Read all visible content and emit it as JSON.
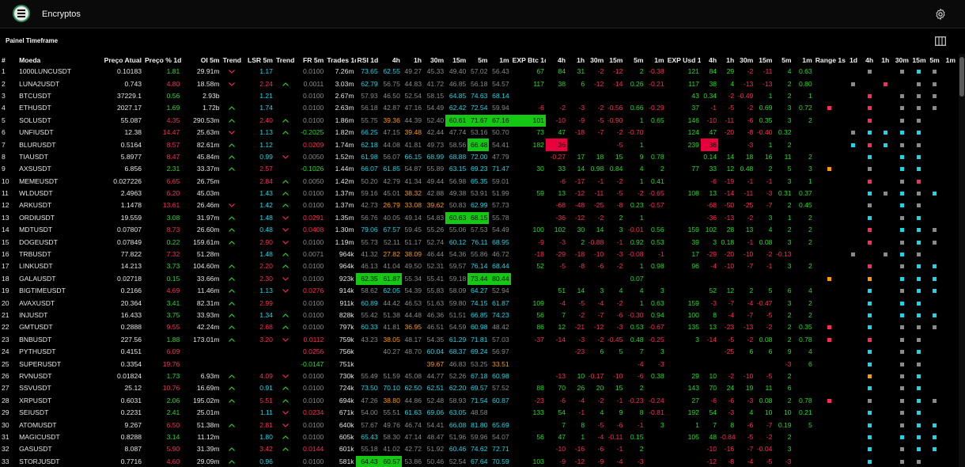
{
  "app": {
    "title": "Encryptos",
    "panel_title": "Painel Timeframe"
  },
  "colors": {
    "green": "#22dd22",
    "red": "#ff2a55",
    "cyan": "#18d8e8",
    "orange": "#ff9a00",
    "gray": "#8a8a8a",
    "white": "#e6e6e6",
    "bg_green": "#14c814",
    "bg_red": "#e8003c"
  },
  "columns": [
    "#",
    "Moeda",
    "Preço Atual",
    "Preço % 1d",
    "OI 5m",
    "Trend 5m",
    "LSR 5m",
    "Trend 5m",
    "FR 5m",
    "Trades 1d",
    "RSI 1d",
    "4h",
    "1h",
    "30m",
    "15m",
    "5m",
    "1m",
    "EXP Btc 1d",
    "4h",
    "1h",
    "30m",
    "15m",
    "5m",
    "1m",
    "EXP Usd 1d",
    "4h",
    "1h",
    "30m",
    "15m",
    "5m",
    "1m",
    "Range 1s",
    "1d",
    "4h",
    "1h",
    "30m",
    "15m",
    "5m",
    "1m"
  ],
  "rows": [
    [
      "1",
      "1000LUNCUSDT",
      "0.10183",
      "1.81",
      "29.91m",
      "v",
      "1.17",
      "",
      "0.0100",
      "7.26m",
      "73.65",
      "62.55",
      "49.27",
      "45.33",
      "49.40",
      "57.02",
      "56.43",
      "67",
      "84",
      "31",
      "-2",
      "-12",
      "2",
      "-0.38",
      "121",
      "84",
      "29",
      "-2",
      "-11",
      "4",
      "0.63",
      "",
      "",
      "g",
      "",
      "g",
      "c",
      "g",
      ""
    ],
    [
      "2",
      "LUNA2USDT",
      "0.743",
      "4.80",
      "18.58m",
      "v",
      "2.24",
      "^",
      "0.0011",
      "3.03m",
      "62.79",
      "56.75",
      "44.83",
      "41.72",
      "46.85",
      "56.18",
      "54.57",
      "117",
      "38",
      "6",
      "-12",
      "-14",
      "0.26",
      "-0.21",
      "117",
      "38",
      "4",
      "-13",
      "-13",
      "2",
      "0.80",
      "",
      "g",
      "",
      "r",
      "",
      "g",
      "g",
      ""
    ],
    [
      "3",
      "BTCUSDT",
      "37229.1",
      "0.56",
      "2.93b",
      "",
      "1.21",
      "",
      "0.0100",
      "2.67m",
      "57.93",
      "46.50",
      "52.54",
      "58.15",
      "64.85",
      "74.63",
      "68.14",
      "",
      "",
      "",
      "",
      "",
      "",
      "",
      "43",
      "0.34",
      "-2",
      "-0.49",
      "1",
      "2",
      "1",
      "",
      "",
      "r",
      "",
      "g",
      "g",
      "g",
      ""
    ],
    [
      "4",
      "ETHUSDT",
      "2027.17",
      "1.69",
      "1.72b",
      "^",
      "1.74",
      "",
      "0.0100",
      "2.63m",
      "56.18",
      "42.87",
      "47.16",
      "54.49",
      "62.42",
      "72.54",
      "59.94",
      "-6",
      "-2",
      "-3",
      "-2",
      "-0.56",
      "0.66",
      "-0.29",
      "37",
      "-1",
      "-5",
      "-2",
      "0.69",
      "3",
      "0.72",
      "r",
      "",
      "r",
      "",
      "g",
      "g",
      "g",
      ""
    ],
    [
      "5",
      "SOLUSDT",
      "55.087",
      "4.35",
      "290.53m",
      "^",
      "2.40",
      "^",
      "0.0100",
      "1.86m",
      "55.75",
      "39.36",
      "44.39",
      "52.40",
      "60.61",
      "71.67",
      "67.16",
      "101",
      "-10",
      "-9",
      "-5",
      "-0.90",
      "1",
      "0.65",
      "146",
      "-10",
      "-11",
      "-6",
      "0.35",
      "3",
      "2",
      "",
      "",
      "r",
      "",
      "g",
      "g",
      "",
      ""
    ],
    [
      "6",
      "UNFIUSDT",
      "12.38",
      "14.47",
      "25.63m",
      "v",
      "1.13",
      "^",
      "-0.2025",
      "1.82m",
      "66.25",
      "47.15",
      "39.48",
      "42.44",
      "47.74",
      "53.16",
      "50.70",
      "73",
      "47",
      "-18",
      "-7",
      "-2",
      "-0.70",
      "",
      "124",
      "47",
      "-20",
      "-8",
      "-0.40",
      "0.32",
      "",
      "",
      "g",
      "c",
      "c",
      "c",
      "c",
      ""
    ],
    [
      "7",
      "BLURUSDT",
      "0.5164",
      "8.57",
      "82.61m",
      "^",
      "1.12",
      "",
      "0.0209",
      "1.74m",
      "62.18",
      "44.08",
      "41.81",
      "49.73",
      "58.56",
      "66.48",
      "54.41",
      "182",
      "36",
      "",
      "",
      "-5",
      "1",
      "",
      "239",
      "36",
      "",
      "-3",
      "1",
      "2",
      "",
      "",
      "c",
      "r",
      "c",
      "g",
      "g",
      "",
      ""
    ],
    [
      "8",
      "TIAUSDT",
      "5.8977",
      "8.47",
      "45.84m",
      "^",
      "0.99",
      "v",
      "0.0050",
      "1.52m",
      "61.98",
      "56.07",
      "66.15",
      "68.99",
      "68.88",
      "72.00",
      "47.79",
      "",
      "-0.27",
      "17",
      "18",
      "15",
      "9",
      "0.78",
      "",
      "0.14",
      "14",
      "18",
      "16",
      "11",
      "2",
      "",
      "",
      "c",
      "",
      "c",
      "c",
      "",
      ""
    ],
    [
      "9",
      "AXSUSDT",
      "6.856",
      "2.31",
      "33.37m",
      "^",
      "2.57",
      "",
      "-0.1026",
      "1.44m",
      "66.07",
      "61.85",
      "54.87",
      "55.89",
      "63.15",
      "69.23",
      "71.47",
      "30",
      "33",
      "14",
      "0.98",
      "0.84",
      "4",
      "2",
      "77",
      "33",
      "12",
      "0.48",
      "2",
      "5",
      "3",
      "o",
      "",
      "g",
      "",
      "c",
      "c",
      "",
      ""
    ],
    [
      "10",
      "MEMEUSDT",
      "0.027226",
      "6.65",
      "26.75m",
      "",
      "2.84",
      "^",
      "0.0050",
      "1.42m",
      "50.20",
      "42.79",
      "41.34",
      "49.44",
      "56.98",
      "65.35",
      "59.01",
      "",
      "-6",
      "-17",
      "-1",
      "-2",
      "1",
      "0.41",
      "",
      "-6",
      "-19",
      "-1",
      "-1",
      "3",
      "1",
      "",
      "",
      "r",
      "",
      "g",
      "r",
      "",
      ""
    ],
    [
      "11",
      "WLDUSDT",
      "2.4963",
      "6.20",
      "45.03m",
      "",
      "1.43",
      "^",
      "0.0100",
      "1.37m",
      "59.16",
      "45.01",
      "38.32",
      "42.88",
      "49.38",
      "53.91",
      "51.99",
      "59",
      "13",
      "-12",
      "-11",
      "-5",
      "-2",
      "-0.65",
      "108",
      "13",
      "-14",
      "-11",
      "-3",
      "0.31",
      "0.37",
      "",
      "",
      "c",
      "g",
      "c",
      "g",
      "c",
      ""
    ],
    [
      "12",
      "ARKUSDT",
      "1.1478",
      "13.61",
      "26.46m",
      "v",
      "1.42",
      "^",
      "0.0100",
      "1.37m",
      "42.73",
      "26.79",
      "33.08",
      "39.62",
      "50.83",
      "62.99",
      "57.73",
      "",
      "-68",
      "-48",
      "-25",
      "-8",
      "0.23",
      "-0.57",
      "",
      "-68",
      "-50",
      "-25",
      "-7",
      "2",
      "0.45",
      "",
      "",
      "g",
      "",
      "c",
      "g",
      "",
      ""
    ],
    [
      "13",
      "ORDIUSDT",
      "19.559",
      "3.08",
      "31.97m",
      "^",
      "1.48",
      "v",
      "0.0291",
      "1.35m",
      "56.76",
      "40.05",
      "49.14",
      "54.83",
      "60.63",
      "68.15",
      "55.78",
      "",
      "-36",
      "-12",
      "-2",
      "2",
      "1",
      "",
      "",
      "-36",
      "-13",
      "-2",
      "3",
      "1",
      "2",
      "",
      "",
      "c",
      "",
      "g",
      "c",
      "",
      ""
    ],
    [
      "14",
      "MDTUSDT",
      "0.07807",
      "8.73",
      "26.60m",
      "^",
      "0.48",
      "v",
      "0.0408",
      "1.30m",
      "79.06",
      "67.57",
      "59.45",
      "55.26",
      "55.06",
      "57.53",
      "54.49",
      "100",
      "102",
      "30",
      "14",
      "3",
      "-0.01",
      "0.56",
      "159",
      "102",
      "28",
      "13",
      "4",
      "2",
      "2",
      "",
      "",
      "r",
      "",
      "c",
      "c",
      "g",
      ""
    ],
    [
      "15",
      "DOGEUSDT",
      "0.07849",
      "0.22",
      "159.61m",
      "^",
      "2.90",
      "v",
      "0.0100",
      "1.19m",
      "55.73",
      "52.11",
      "51.17",
      "52.74",
      "60.12",
      "76.11",
      "68.95",
      "-9",
      "-3",
      "2",
      "-0.88",
      "-1",
      "0.92",
      "0.53",
      "39",
      "3",
      "0.18",
      "-1",
      "0.08",
      "3",
      "2",
      "",
      "",
      "r",
      "",
      "g",
      "c",
      "g",
      ""
    ],
    [
      "16",
      "TRBUSDT",
      "77.822",
      "7.32",
      "51.28m",
      "",
      "1.48",
      "^",
      "0.0071",
      "964k",
      "41.32",
      "27.82",
      "38.09",
      "46.44",
      "54.36",
      "55.86",
      "46.72",
      "-18",
      "-29",
      "-18",
      "-10",
      "-3",
      "-0.08",
      "-1",
      "17",
      "-29",
      "-20",
      "-10",
      "-2",
      "-0.13",
      "",
      "",
      "g",
      "",
      "g",
      "c",
      "g",
      ""
    ],
    [
      "17",
      "LINKUSDT",
      "14.213",
      "3.73",
      "104.60m",
      "^",
      "2.20",
      "^",
      "0.0100",
      "964k",
      "46.13",
      "41.04",
      "49.50",
      "52.31",
      "59.57",
      "76.14",
      "68.44",
      "52",
      "-5",
      "-8",
      "-6",
      "-2",
      "1",
      "0.98",
      "96",
      "-4",
      "-10",
      "-7",
      "-1",
      "3",
      "2",
      "",
      "",
      "r",
      "",
      "g",
      "c",
      "c",
      ""
    ],
    [
      "18",
      "GALAUSDT",
      "0.02718",
      "0.15",
      "33.66m",
      "^",
      "2.30",
      "v",
      "0.0100",
      "923k",
      "62.35",
      "61.87",
      "55.34",
      "55.41",
      "59.18",
      "73.44",
      "80.44",
      "",
      "",
      "",
      "",
      "",
      "0.07",
      "",
      "",
      "",
      "",
      "",
      "",
      "",
      "",
      "o",
      "",
      "o",
      "",
      "c",
      "c",
      "c",
      ""
    ],
    [
      "19",
      "BIGTIMEUSDT",
      "0.2166",
      "4.69",
      "11.46m",
      "^",
      "1.13",
      "v",
      "0.0276",
      "914k",
      "58.62",
      "62.05",
      "54.39",
      "55.83",
      "58.09",
      "64.27",
      "52.94",
      "",
      "51",
      "14",
      "3",
      "4",
      "4",
      "3",
      "",
      "52",
      "12",
      "2",
      "5",
      "6",
      "4",
      "",
      "",
      "c",
      "",
      "g",
      "c",
      "c",
      ""
    ],
    [
      "20",
      "AVAXUSDT",
      "20.364",
      "3.41",
      "82.31m",
      "^",
      "2.99",
      "",
      "0.0100",
      "911k",
      "60.89",
      "44.42",
      "46.53",
      "51.63",
      "59.80",
      "74.15",
      "61.87",
      "109",
      "-4",
      "-5",
      "-4",
      "-2",
      "1",
      "0.63",
      "159",
      "-3",
      "-7",
      "-4",
      "-0.47",
      "3",
      "2",
      "",
      "",
      "c",
      "",
      "c",
      "c",
      "",
      ""
    ],
    [
      "21",
      "INJUSDT",
      "16.433",
      "3.75",
      "33.93m",
      "^",
      "1.34",
      "^",
      "0.0100",
      "828k",
      "55.42",
      "51.38",
      "44.48",
      "46.36",
      "51.51",
      "66.85",
      "74.23",
      "56",
      "7",
      "-2",
      "-7",
      "-6",
      "-0.30",
      "0.94",
      "100",
      "8",
      "-4",
      "-7",
      "-5",
      "2",
      "2",
      "",
      "",
      "c",
      "",
      "c",
      "c",
      "c",
      ""
    ],
    [
      "22",
      "GMTUSDT",
      "0.2888",
      "9.55",
      "42.24m",
      "^",
      "2.68",
      "^",
      "0.0100",
      "797k",
      "60.33",
      "41.81",
      "36.95",
      "46.51",
      "54.59",
      "60.98",
      "48.42",
      "86",
      "12",
      "-21",
      "-12",
      "-3",
      "0.53",
      "-0.67",
      "135",
      "13",
      "-23",
      "-13",
      "-2",
      "2",
      "0.35",
      "r",
      "",
      "c",
      "",
      "g",
      "g",
      "g",
      ""
    ],
    [
      "23",
      "BNBUSDT",
      "227.56",
      "1.88",
      "173.01m",
      "^",
      "3.20",
      "v",
      "0.0112",
      "759k",
      "43.23",
      "38.05",
      "48.17",
      "54.35",
      "61.29",
      "71.81",
      "57.03",
      "-37",
      "-14",
      "-3",
      "-2",
      "-0.45",
      "0.48",
      "-0.25",
      "3",
      "-14",
      "-5",
      "-2",
      "0.08",
      "2",
      "0.78",
      "r",
      "",
      "r",
      "",
      "g",
      "g",
      "",
      ""
    ],
    [
      "24",
      "PYTHUSDT",
      "0.4151",
      "6.09",
      "",
      "",
      "",
      "",
      "0.0256",
      "756k",
      "",
      "40.27",
      "48.70",
      "60.04",
      "68.37",
      "69.24",
      "56.97",
      "",
      "",
      "-23",
      "6",
      "5",
      "7",
      "3",
      "",
      "",
      "-25",
      "6",
      "6",
      "9",
      "4",
      "",
      "",
      "c",
      "",
      "g",
      "c",
      "",
      ""
    ],
    [
      "25",
      "SUPERUSDT",
      "0.3354",
      "19.76",
      "",
      "",
      "",
      "",
      "-0.0147",
      "751k",
      "",
      "",
      "",
      "39.67",
      "46.83",
      "53.25",
      "33.51",
      "",
      "",
      "",
      "",
      "",
      "-4",
      "-3",
      "",
      "",
      "",
      "",
      "",
      "-3",
      "6",
      "",
      "",
      "c",
      "",
      "g",
      "g",
      "",
      ""
    ],
    [
      "26",
      "RVNUSDT",
      "0.01824",
      "1.73",
      "6.93m",
      "^",
      "4.09",
      "v",
      "0.0100",
      "730k",
      "55.49",
      "51.59",
      "45.08",
      "44.77",
      "52.26",
      "67.18",
      "60.98",
      "",
      "-13",
      "10",
      "-0.17",
      "-10",
      "-6",
      "0.38",
      "29",
      "10",
      "-2",
      "-10",
      "-5",
      "2",
      "",
      "",
      "",
      "o",
      "",
      "g",
      "c",
      "",
      ""
    ],
    [
      "27",
      "SSVUSDT",
      "25.12",
      "10.76",
      "16.69m",
      "^",
      "0.91",
      "^",
      "0.0100",
      "724k",
      "73.50",
      "70.10",
      "62.50",
      "62.51",
      "62.20",
      "69.57",
      "57.52",
      "88",
      "70",
      "26",
      "20",
      "15",
      "2",
      "",
      "143",
      "70",
      "24",
      "19",
      "11",
      "6",
      "",
      "",
      "",
      "c",
      "",
      "g",
      "c",
      "",
      ""
    ],
    [
      "28",
      "XRPUSDT",
      "0.6031",
      "2.06",
      "195.02m",
      "^",
      "5.51",
      "^",
      "0.0100",
      "694k",
      "47.26",
      "38.80",
      "44.86",
      "52.48",
      "58.93",
      "71.54",
      "60.87",
      "-23",
      "-6",
      "-4",
      "-2",
      "-1",
      "-0.23",
      "-0.24",
      "27",
      "-6",
      "-6",
      "-3",
      "0.08",
      "2",
      "0.78",
      "r",
      "",
      "g",
      "",
      "g",
      "c",
      "g",
      ""
    ],
    [
      "29",
      "SEIUSDT",
      "0.2231",
      "2.41",
      "25.01m",
      "",
      "1.11",
      "v",
      "0.0234",
      "671k",
      "54.00",
      "55.51",
      "61.63",
      "69.06",
      "63.05",
      "48.58",
      "",
      "133",
      "54",
      "-1",
      "4",
      "9",
      "8",
      "-0.81",
      "192",
      "54",
      "-3",
      "4",
      "10",
      "10",
      "0.21",
      "",
      "",
      "c",
      "",
      "g",
      "c",
      "",
      ""
    ],
    [
      "30",
      "ATOMUSDT",
      "9.267",
      "6.50",
      "51.38m",
      "^",
      "2.81",
      "v",
      "0.0100",
      "640k",
      "57.67",
      "49.76",
      "46.74",
      "54.41",
      "66.08",
      "81.80",
      "65.69",
      "",
      "7",
      "8",
      "-5",
      "-6",
      "-1",
      "3",
      "1",
      "7",
      "8",
      "-6",
      "-7",
      "0.19",
      "5",
      "",
      "",
      "c",
      "",
      "g",
      "c",
      "c",
      ""
    ],
    [
      "31",
      "MAGICUSDT",
      "0.8288",
      "3.14",
      "11.12m",
      "",
      "1.80",
      "^",
      "0.0100",
      "605k",
      "65.43",
      "58.30",
      "47.14",
      "48.47",
      "51.96",
      "59.96",
      "54.07",
      "56",
      "47",
      "1",
      "-4",
      "-0.11",
      "0.15",
      "",
      "105",
      "48",
      "-0.84",
      "-5",
      "-2",
      "2",
      "",
      "",
      "",
      "c",
      "",
      "c",
      "c",
      "c",
      ""
    ],
    [
      "32",
      "GASUSDT",
      "8.087",
      "5.90",
      "31.39m",
      "^",
      "3.42",
      "^",
      "0.0144",
      "601k",
      "55.18",
      "41.02",
      "42.72",
      "51.92",
      "60.46",
      "74.62",
      "72.71",
      "",
      "-10",
      "-16",
      "-6",
      "-1",
      "2",
      "",
      "",
      "-10",
      "-16",
      "-7",
      "-0.04",
      "3",
      "",
      "",
      "",
      "c",
      "",
      "g",
      "c",
      "c",
      ""
    ],
    [
      "33",
      "STORJUSDT",
      "0.7716",
      "4.60",
      "29.09m",
      "^",
      "0.96",
      "",
      "0.0100",
      "581k",
      "64.43",
      "60.57",
      "53.86",
      "50.46",
      "52.54",
      "67.64",
      "70.59",
      "103",
      "-9",
      "-12",
      "-9",
      "-4",
      "-3",
      "",
      "",
      "-12",
      "-8",
      "-4",
      "-5",
      "-3",
      "",
      "",
      "",
      "c",
      "",
      "g",
      "g",
      "",
      ""
    ]
  ]
}
